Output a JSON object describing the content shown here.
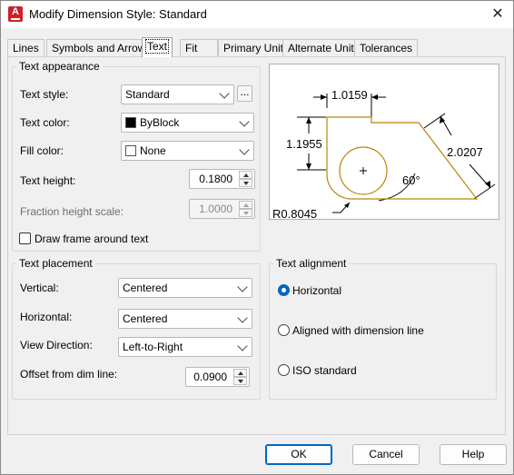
{
  "window": {
    "title": "Modify Dimension Style: Standard",
    "app_icon": "A",
    "close_glyph": "✕"
  },
  "tabs": [
    {
      "label": "Lines"
    },
    {
      "label": "Symbols and Arrows"
    },
    {
      "label": "Text",
      "active": true
    },
    {
      "label": "Fit"
    },
    {
      "label": "Primary Units"
    },
    {
      "label": "Alternate Units"
    },
    {
      "label": "Tolerances"
    }
  ],
  "text_appearance": {
    "legend": "Text appearance",
    "text_style": {
      "label": "Text style:",
      "value": "Standard",
      "browse_label": "..."
    },
    "text_color": {
      "label": "Text color:",
      "value": "ByBlock",
      "swatch": "#000000"
    },
    "fill_color": {
      "label": "Fill color:",
      "value": "None",
      "swatch": "#ffffff"
    },
    "text_height": {
      "label": "Text height:",
      "value": "0.1800"
    },
    "fraction_height_scale": {
      "label": "Fraction height scale:",
      "value": "1.0000"
    },
    "draw_frame": {
      "label": "Draw frame around text",
      "checked": false
    }
  },
  "text_placement": {
    "legend": "Text placement",
    "vertical": {
      "label": "Vertical:",
      "value": "Centered"
    },
    "horizontal": {
      "label": "Horizontal:",
      "value": "Centered"
    },
    "view_direction": {
      "label": "View Direction:",
      "value": "Left-to-Right"
    },
    "offset": {
      "label": "Offset from dim line:",
      "value": "0.0900"
    }
  },
  "text_alignment": {
    "legend": "Text alignment",
    "options": [
      {
        "label": "Horizontal",
        "selected": true
      },
      {
        "label": "Aligned with dimension line",
        "selected": false
      },
      {
        "label": "ISO standard",
        "selected": false
      }
    ]
  },
  "preview": {
    "dim_top": "1.0159",
    "dim_left": "1.1955",
    "dim_right": "2.0207",
    "angle": "60°",
    "radius": "R0.8045",
    "shape_color": "#b8860b"
  },
  "buttons": {
    "ok": "OK",
    "cancel": "Cancel",
    "help": "Help"
  }
}
